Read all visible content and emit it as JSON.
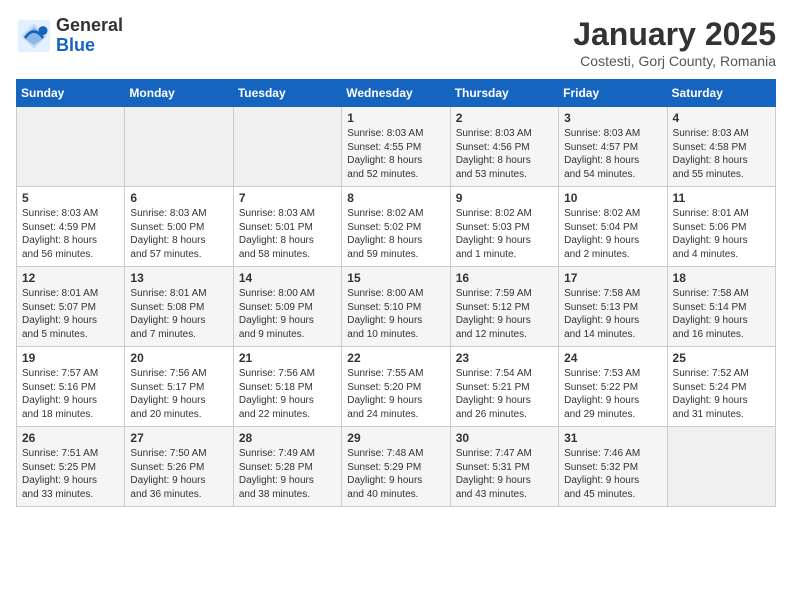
{
  "logo": {
    "general": "General",
    "blue": "Blue"
  },
  "title": "January 2025",
  "subtitle": "Costesti, Gorj County, Romania",
  "headers": [
    "Sunday",
    "Monday",
    "Tuesday",
    "Wednesday",
    "Thursday",
    "Friday",
    "Saturday"
  ],
  "weeks": [
    [
      {
        "day": "",
        "info": ""
      },
      {
        "day": "",
        "info": ""
      },
      {
        "day": "",
        "info": ""
      },
      {
        "day": "1",
        "info": "Sunrise: 8:03 AM\nSunset: 4:55 PM\nDaylight: 8 hours\nand 52 minutes."
      },
      {
        "day": "2",
        "info": "Sunrise: 8:03 AM\nSunset: 4:56 PM\nDaylight: 8 hours\nand 53 minutes."
      },
      {
        "day": "3",
        "info": "Sunrise: 8:03 AM\nSunset: 4:57 PM\nDaylight: 8 hours\nand 54 minutes."
      },
      {
        "day": "4",
        "info": "Sunrise: 8:03 AM\nSunset: 4:58 PM\nDaylight: 8 hours\nand 55 minutes."
      }
    ],
    [
      {
        "day": "5",
        "info": "Sunrise: 8:03 AM\nSunset: 4:59 PM\nDaylight: 8 hours\nand 56 minutes."
      },
      {
        "day": "6",
        "info": "Sunrise: 8:03 AM\nSunset: 5:00 PM\nDaylight: 8 hours\nand 57 minutes."
      },
      {
        "day": "7",
        "info": "Sunrise: 8:03 AM\nSunset: 5:01 PM\nDaylight: 8 hours\nand 58 minutes."
      },
      {
        "day": "8",
        "info": "Sunrise: 8:02 AM\nSunset: 5:02 PM\nDaylight: 8 hours\nand 59 minutes."
      },
      {
        "day": "9",
        "info": "Sunrise: 8:02 AM\nSunset: 5:03 PM\nDaylight: 9 hours\nand 1 minute."
      },
      {
        "day": "10",
        "info": "Sunrise: 8:02 AM\nSunset: 5:04 PM\nDaylight: 9 hours\nand 2 minutes."
      },
      {
        "day": "11",
        "info": "Sunrise: 8:01 AM\nSunset: 5:06 PM\nDaylight: 9 hours\nand 4 minutes."
      }
    ],
    [
      {
        "day": "12",
        "info": "Sunrise: 8:01 AM\nSunset: 5:07 PM\nDaylight: 9 hours\nand 5 minutes."
      },
      {
        "day": "13",
        "info": "Sunrise: 8:01 AM\nSunset: 5:08 PM\nDaylight: 9 hours\nand 7 minutes."
      },
      {
        "day": "14",
        "info": "Sunrise: 8:00 AM\nSunset: 5:09 PM\nDaylight: 9 hours\nand 9 minutes."
      },
      {
        "day": "15",
        "info": "Sunrise: 8:00 AM\nSunset: 5:10 PM\nDaylight: 9 hours\nand 10 minutes."
      },
      {
        "day": "16",
        "info": "Sunrise: 7:59 AM\nSunset: 5:12 PM\nDaylight: 9 hours\nand 12 minutes."
      },
      {
        "day": "17",
        "info": "Sunrise: 7:58 AM\nSunset: 5:13 PM\nDaylight: 9 hours\nand 14 minutes."
      },
      {
        "day": "18",
        "info": "Sunrise: 7:58 AM\nSunset: 5:14 PM\nDaylight: 9 hours\nand 16 minutes."
      }
    ],
    [
      {
        "day": "19",
        "info": "Sunrise: 7:57 AM\nSunset: 5:16 PM\nDaylight: 9 hours\nand 18 minutes."
      },
      {
        "day": "20",
        "info": "Sunrise: 7:56 AM\nSunset: 5:17 PM\nDaylight: 9 hours\nand 20 minutes."
      },
      {
        "day": "21",
        "info": "Sunrise: 7:56 AM\nSunset: 5:18 PM\nDaylight: 9 hours\nand 22 minutes."
      },
      {
        "day": "22",
        "info": "Sunrise: 7:55 AM\nSunset: 5:20 PM\nDaylight: 9 hours\nand 24 minutes."
      },
      {
        "day": "23",
        "info": "Sunrise: 7:54 AM\nSunset: 5:21 PM\nDaylight: 9 hours\nand 26 minutes."
      },
      {
        "day": "24",
        "info": "Sunrise: 7:53 AM\nSunset: 5:22 PM\nDaylight: 9 hours\nand 29 minutes."
      },
      {
        "day": "25",
        "info": "Sunrise: 7:52 AM\nSunset: 5:24 PM\nDaylight: 9 hours\nand 31 minutes."
      }
    ],
    [
      {
        "day": "26",
        "info": "Sunrise: 7:51 AM\nSunset: 5:25 PM\nDaylight: 9 hours\nand 33 minutes."
      },
      {
        "day": "27",
        "info": "Sunrise: 7:50 AM\nSunset: 5:26 PM\nDaylight: 9 hours\nand 36 minutes."
      },
      {
        "day": "28",
        "info": "Sunrise: 7:49 AM\nSunset: 5:28 PM\nDaylight: 9 hours\nand 38 minutes."
      },
      {
        "day": "29",
        "info": "Sunrise: 7:48 AM\nSunset: 5:29 PM\nDaylight: 9 hours\nand 40 minutes."
      },
      {
        "day": "30",
        "info": "Sunrise: 7:47 AM\nSunset: 5:31 PM\nDaylight: 9 hours\nand 43 minutes."
      },
      {
        "day": "31",
        "info": "Sunrise: 7:46 AM\nSunset: 5:32 PM\nDaylight: 9 hours\nand 45 minutes."
      },
      {
        "day": "",
        "info": ""
      }
    ]
  ]
}
